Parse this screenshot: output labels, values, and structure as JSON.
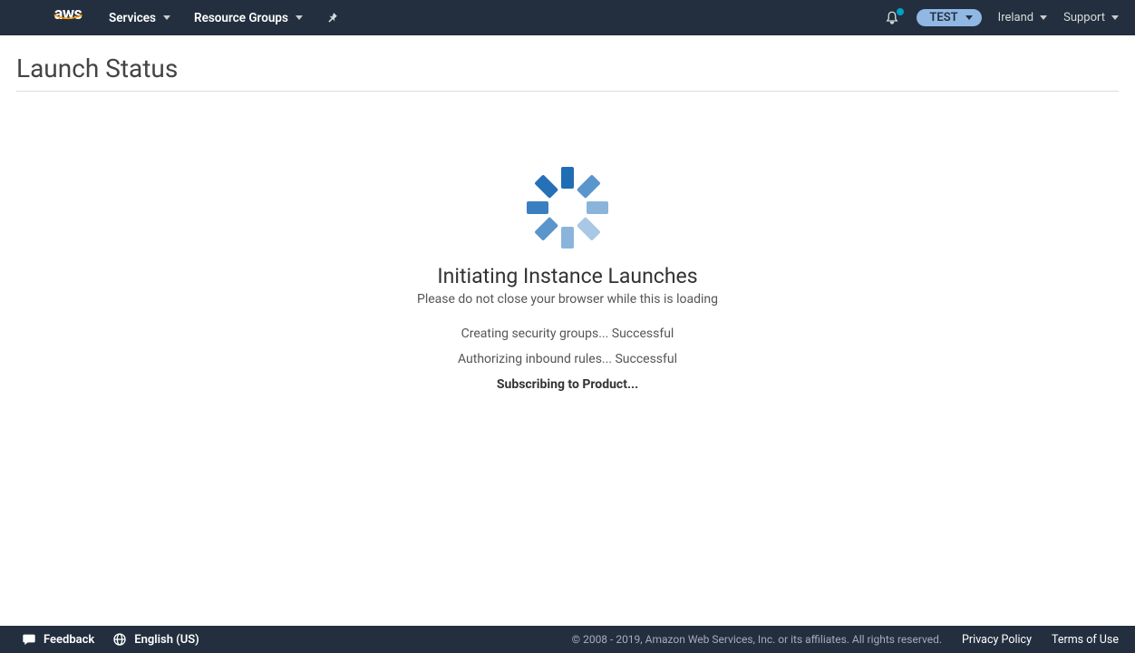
{
  "nav": {
    "logo_text": "aws",
    "services_label": "Services",
    "resource_groups_label": "Resource Groups",
    "account_pill": "TEST",
    "region": "Ireland",
    "support_label": "Support"
  },
  "page": {
    "title": "Launch Status",
    "status_heading": "Initiating Instance Launches",
    "status_sub": "Please do not close your browser while this is loading",
    "steps": [
      {
        "text": "Creating security groups... Successful",
        "bold": false
      },
      {
        "text": "Authorizing inbound rules... Successful",
        "bold": false
      },
      {
        "text": "Subscribing to Product...",
        "bold": true
      }
    ]
  },
  "footer": {
    "feedback_label": "Feedback",
    "language_label": "English (US)",
    "copyright": "© 2008 - 2019, Amazon Web Services, Inc. or its affiliates. All rights reserved.",
    "privacy_label": "Privacy Policy",
    "terms_label": "Terms of Use"
  }
}
